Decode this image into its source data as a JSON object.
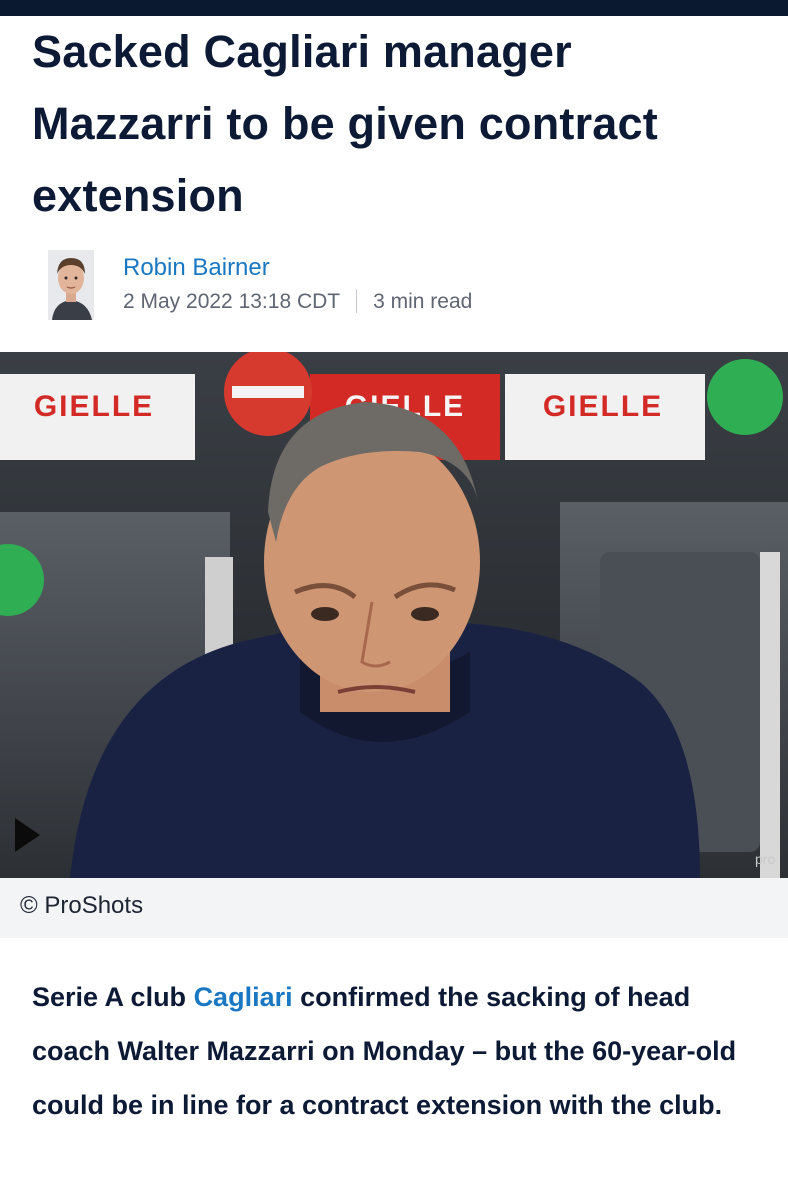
{
  "article": {
    "headline": "Sacked Cagliari manager Mazzarri to be given contract extension",
    "author": "Robin Bairner",
    "date": "2 May 2022 13:18 CDT",
    "read_time": "3 min read",
    "image_credit": "© ProShots",
    "image_watermark": "pro",
    "banner_text": "GIELLE",
    "body": {
      "before_link": "Serie A club ",
      "link_text": "Cagliari",
      "after_link": " confirmed the sacking of head coach Walter Mazzarri on Monday – but the 60-year-old could be in line for a contract extension with the club."
    }
  },
  "icons": {
    "play": "play-arrow-icon"
  },
  "colors": {
    "topbar": "#0a1930",
    "headline": "#0d1a36",
    "link": "#1a78c2",
    "meta": "#5f6672",
    "banner_red": "#d42a26"
  }
}
